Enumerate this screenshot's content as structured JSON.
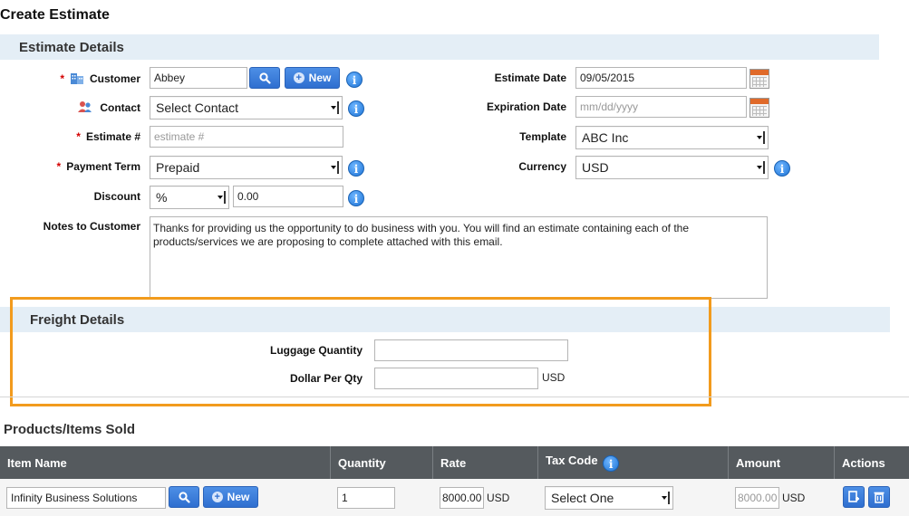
{
  "page": {
    "title": "Create Estimate"
  },
  "estimate_details": {
    "heading": "Estimate Details",
    "customer": {
      "label": "Customer",
      "value": "Abbey",
      "new_label": "New"
    },
    "contact": {
      "label": "Contact",
      "value": "Select Contact"
    },
    "estimate_no": {
      "label": "Estimate #",
      "placeholder": "estimate #"
    },
    "payment_term": {
      "label": "Payment Term",
      "value": "Prepaid"
    },
    "discount": {
      "label": "Discount",
      "type": "%",
      "value": "0.00"
    },
    "notes": {
      "label": "Notes to Customer",
      "value": "Thanks for providing us the opportunity to do business with you.  You will find an estimate containing each of the products/services we are proposing to complete attached with this email."
    },
    "estimate_date": {
      "label": "Estimate Date",
      "value": "09/05/2015"
    },
    "expiration_date": {
      "label": "Expiration Date",
      "placeholder": "mm/dd/yyyy"
    },
    "template": {
      "label": "Template",
      "value": "ABC Inc"
    },
    "currency": {
      "label": "Currency",
      "value": "USD"
    }
  },
  "freight_details": {
    "heading": "Freight Details",
    "luggage_quantity": {
      "label": "Luggage Quantity",
      "value": ""
    },
    "dollar_per_qty": {
      "label": "Dollar Per Qty",
      "value": "",
      "unit": "USD"
    }
  },
  "products": {
    "heading": "Products/Items Sold",
    "columns": [
      "Item Name",
      "Quantity",
      "Rate",
      "Tax Code",
      "Amount",
      "Actions"
    ],
    "row": {
      "item_name": "Infinity Business Solutions",
      "new_label": "New",
      "quantity": "1",
      "rate": "8000.00",
      "rate_unit": "USD",
      "tax_code": "Select One",
      "amount": "8000.00",
      "amount_unit": "USD"
    }
  },
  "colors": {
    "accent_blue": "#2f6fd0",
    "highlight_orange": "#f29b1d",
    "section_bg": "#e4eef6",
    "table_header": "#555a5e",
    "required": "#d40000"
  }
}
